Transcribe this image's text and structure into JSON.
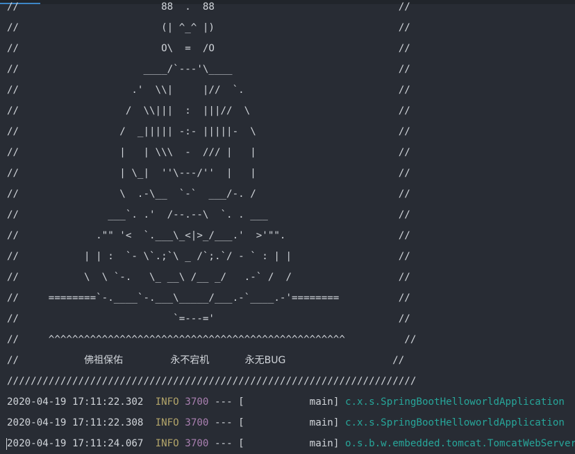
{
  "banner_lines": [
    "//                        88  .  88                               //",
    "//                        (| ^_^ |)                               //",
    "//                        O\\  =  /O                               //",
    "//                     ____/`---'\\____                            //",
    "//                   .'  \\\\|     |//  `.                          //",
    "//                  /  \\\\|||  :  |||//  \\                         //",
    "//                 /  _||||| -:- |||||-  \\                        //",
    "//                 |   | \\\\\\  -  /// |   |                        //",
    "//                 | \\_|  ''\\---/''  |   |                        //",
    "//                 \\  .-\\__  `-`  ___/-. /                        //",
    "//               ___`. .'  /--.--\\  `. . ___                      //",
    "//             .\"\" '<  `.___\\_<|>_/___.'  >'\"\".                   //",
    "//           | | :  `- \\`.;`\\ _ /`;.`/ - ` : | |                  //",
    "//           \\  \\ `-.   \\_ __\\ /__ _/   .-` /  /                  //",
    "//     ========`-.____`-.___\\_____/___.-`____.-'========          //",
    "//                          `=---='                               //"
  ],
  "carets_line": "//     ^^^^^^^^^^^^^^^^^^^^^^^^^^^^^^^^^^^^^^^^^^^^^^^^^^          //",
  "blessing": {
    "prefix": "//",
    "phrase1": "佛祖保佑",
    "phrase2": "永不宕机",
    "phrase3": "永无BUG",
    "suffix": "//"
  },
  "slash_line": "/////////////////////////////////////////////////////////////////////",
  "logs": [
    {
      "timestamp": "2020-04-19 17:11:22.302",
      "level": "INFO",
      "pid": "3700",
      "sep": "--- [",
      "thread": "           main]",
      "logger": "c.x.s.SpringBootHelloworldApplication"
    },
    {
      "timestamp": "2020-04-19 17:11:22.308",
      "level": "INFO",
      "pid": "3700",
      "sep": "--- [",
      "thread": "           main]",
      "logger": "c.x.s.SpringBootHelloworldApplication"
    },
    {
      "timestamp": "2020-04-19 17:11:24.067",
      "level": "INFO",
      "pid": "3700",
      "sep": "--- [",
      "thread": "           main]",
      "logger": "o.s.b.w.embedded.tomcat.TomcatWebServer"
    }
  ],
  "colors": {
    "background": "#282c34",
    "text": "#d1d5da",
    "level": "#b3a56a",
    "pid": "#a97fb0",
    "logger": "#27a69a"
  }
}
